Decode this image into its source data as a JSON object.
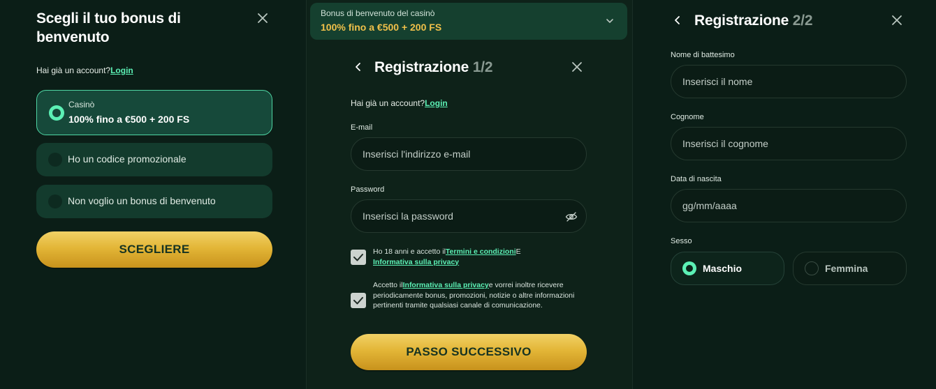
{
  "colors": {
    "background": "#0b1e17",
    "accent": "#5cf0b5",
    "gold": "#e3b637",
    "bonus_text": "#f0c04a",
    "option_bg": "#133b2d"
  },
  "panel1": {
    "title": "Scegli il tuo bonus di benvenuto",
    "account_prompt": "Hai già un account?",
    "login_link": "Login",
    "options": [
      {
        "small": "Casinò",
        "label": "100% fino a €500 + 200 FS",
        "selected": true
      },
      {
        "label": "Ho un codice promozionale",
        "selected": false
      },
      {
        "label": "Non voglio un bonus di benvenuto",
        "selected": false
      }
    ],
    "choose_button": "SCEGLIERE",
    "close_icon": "close-icon"
  },
  "panel2": {
    "bonus_bar": {
      "label": "Bonus di benvenuto del casinò",
      "value": "100% fino a €500 + 200 FS"
    },
    "title": "Registrazione",
    "step": "1/2",
    "account_prompt": "Hai già un account?",
    "login_link": "Login",
    "email": {
      "label": "E-mail",
      "placeholder": "Inserisci l'indirizzo e-mail"
    },
    "password": {
      "label": "Password",
      "placeholder": "Inserisci la password"
    },
    "consent1": {
      "prefix": "Ho 18 anni e accetto il",
      "link1": "Termini e condizioni",
      "middle": "E",
      "link2": "Informativa sulla privacy",
      "checked": true
    },
    "consent2": {
      "prefix": "Accetto il",
      "link": "Informativa sulla privacy",
      "suffix": "e vorrei inoltre ricevere periodicamente bonus, promozioni, notizie o altre informazioni pertinenti tramite qualsiasi canale di comunicazione.",
      "checked": true
    },
    "next_button": "PASSO SUCCESSIVO"
  },
  "panel3": {
    "title": "Registrazione",
    "step": "2/2",
    "first_name": {
      "label": "Nome di battesimo",
      "placeholder": "Inserisci il nome"
    },
    "last_name": {
      "label": "Cognome",
      "placeholder": "Inserisci il cognome"
    },
    "birthdate": {
      "label": "Data di nascita",
      "placeholder": "gg/mm/aaaa"
    },
    "gender": {
      "label": "Sesso",
      "male": "Maschio",
      "female": "Femmina",
      "selected": "Maschio"
    }
  }
}
